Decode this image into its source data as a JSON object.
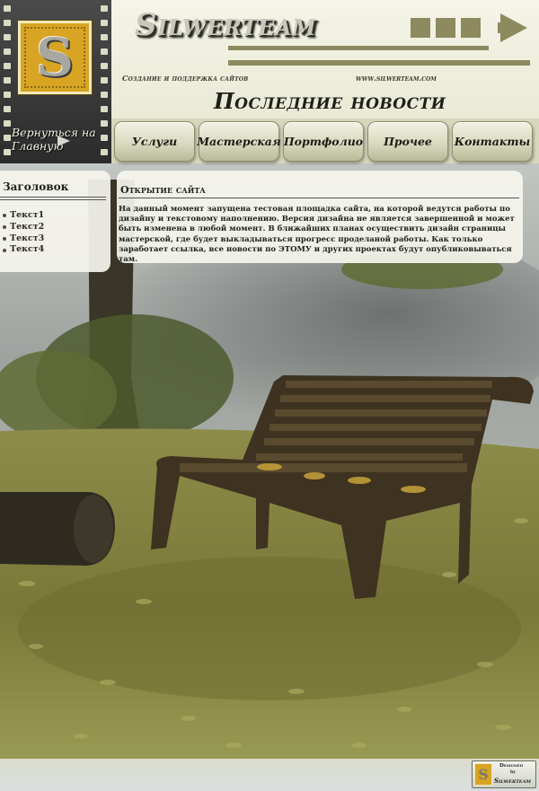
{
  "brand": {
    "logo_letter": "S",
    "name": "Silwerteam",
    "tagline": "Создание и поддержка сайтов",
    "url": "www.silwerteam.com",
    "colors": {
      "olive": "#8c8a5e",
      "gold": "#d8a423",
      "dark": "#2c2c2c"
    }
  },
  "header": {
    "back_home": "Вернуться на Главную",
    "page_title": "Последние новости"
  },
  "nav": {
    "items": [
      {
        "label": "Услуги"
      },
      {
        "label": "Мастерская"
      },
      {
        "label": "Портфолио"
      },
      {
        "label": "Прочее"
      },
      {
        "label": "Контакты"
      }
    ]
  },
  "sidebar": {
    "title": "Заголовок",
    "items": [
      {
        "label": "Текст1"
      },
      {
        "label": "Текст2"
      },
      {
        "label": "Текст3"
      },
      {
        "label": "Текст4"
      }
    ]
  },
  "article": {
    "title": "Открытие сайта",
    "body": "На данный момент запущена тестовая площадка сайта, на которой ведутся работы по дизайну и текстовому наполнению. Версия дизайна не является завершенной и может быть изменена в любой момент. В ближайших планах осуществить дизайн страницы мастерской, где будет выкладываться прогресс проделаной работы. Как только заработает ссылка, все новости по ЭТОМУ и других проектах будут опубликовываться там."
  },
  "footer": {
    "badge_designed": "Designed",
    "badge_by": "by",
    "badge_name": "Silwerteam",
    "badge_letter": "S"
  }
}
